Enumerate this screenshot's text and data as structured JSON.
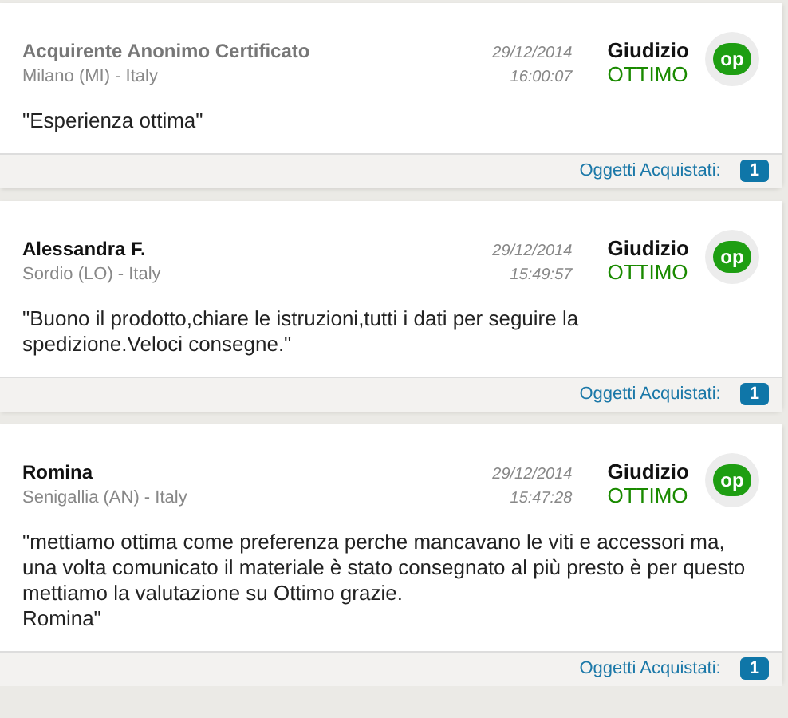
{
  "reviews": [
    {
      "author": "Acquirente Anonimo Certificato",
      "anonymous": true,
      "location": "Milano (MI) - Italy",
      "date": "29/12/2014",
      "time": "16:00:07",
      "rating_label": "Giudizio",
      "rating": "OTTIMO",
      "badge": "op",
      "message": "\"Esperienza ottima\"",
      "items_label": "Oggetti Acquistati:",
      "items_count": "1"
    },
    {
      "author": "Alessandra F.",
      "anonymous": false,
      "location": "Sordio (LO) - Italy",
      "date": "29/12/2014",
      "time": "15:49:57",
      "rating_label": "Giudizio",
      "rating": "OTTIMO",
      "badge": "op",
      "message": "\"Buono il prodotto,chiare le istruzioni,tutti i dati per seguire la\nspedizione.Veloci consegne.\"",
      "items_label": "Oggetti Acquistati:",
      "items_count": "1"
    },
    {
      "author": "Romina",
      "anonymous": false,
      "location": "Senigallia (AN) - Italy",
      "date": "29/12/2014",
      "time": "15:47:28",
      "rating_label": "Giudizio",
      "rating": "OTTIMO",
      "badge": "op",
      "message": "\"mettiamo ottima come preferenza perche mancavano le viti e accessori ma,\nuna volta comunicato il materiale è stato consegnato al più presto è per questo\nmettiamo la valutazione su Ottimo grazie.\nRomina\"",
      "items_label": "Oggetti Acquistati:",
      "items_count": "1"
    }
  ]
}
